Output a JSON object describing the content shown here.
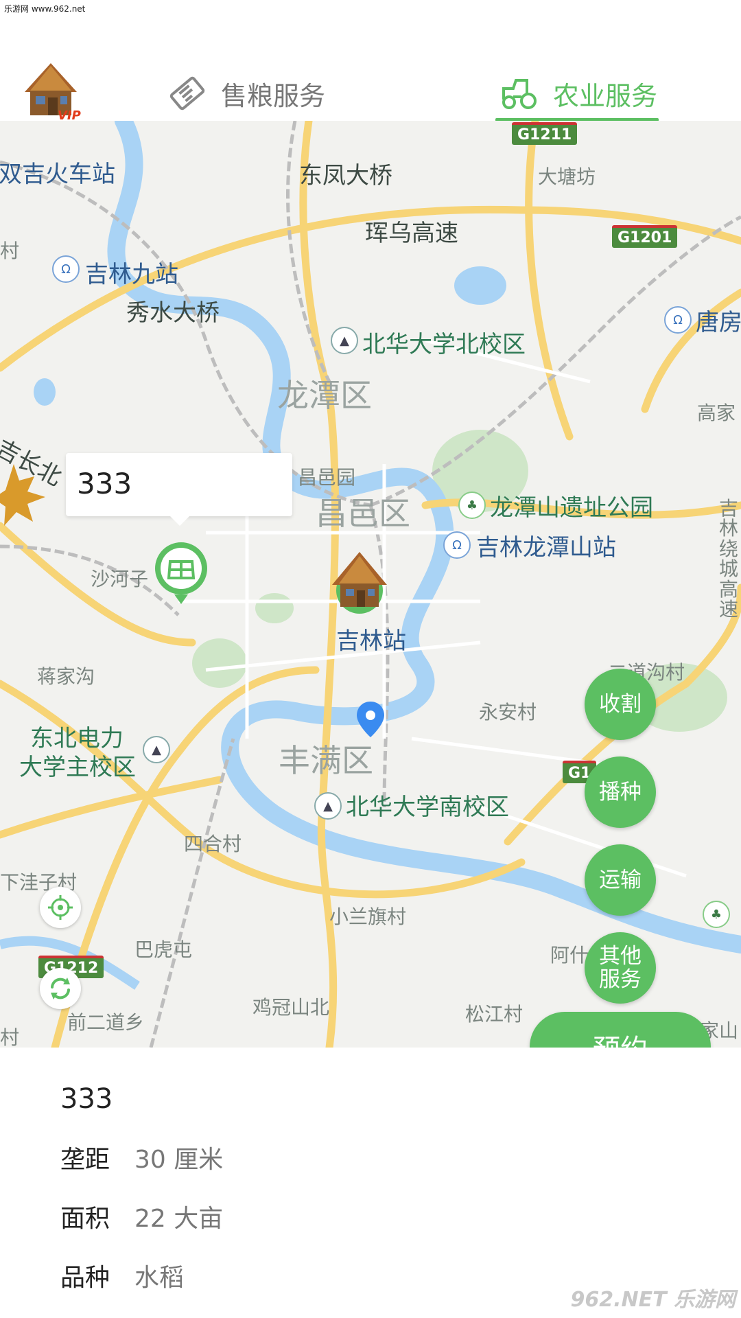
{
  "watermark_top": "乐游网 www.962.net",
  "header": {
    "avatar_badge": "VIP",
    "tabs": [
      {
        "label": "售粮服务",
        "icon": "ticket-icon",
        "active": false
      },
      {
        "label": "农业服务",
        "icon": "tractor-icon",
        "active": true
      }
    ]
  },
  "map": {
    "labels": {
      "l1": "双吉火车站",
      "l2": "东凤大桥",
      "l3": "大塘坊",
      "l4": "珲乌高速",
      "l5": "吉林九站",
      "l6": "秀水大桥",
      "l7": "北华大学北校区",
      "l8": "唐房",
      "l9": "龙潭区",
      "l10": "高家",
      "l11": "吉长北",
      "l12": "昌邑园",
      "l13": "昌邑区",
      "l14": "龙潭山遗址公园",
      "l15": "吉林龙潭山站",
      "l16": "沙河子",
      "l17": "吉林站",
      "l18": "蒋家沟",
      "l19": "二道沟村",
      "l20": "永安村",
      "l21": "东北电力",
      "l22": "大学主校区",
      "l23": "丰满区",
      "l24": "北华大学南校区",
      "l25": "四合村",
      "l26": "下洼子村",
      "l27": "小兰旗村",
      "l28": "巴虎屯",
      "l29": "阿什",
      "l30": "鸡冠山北",
      "l31": "前二道乡",
      "l32": "松江村",
      "l33": "吉林绕城高速",
      "l34": "村",
      "l35": "村",
      "l36": "家山"
    },
    "highways": {
      "g1211": "G1211",
      "g1201": "G1201",
      "g1212": "G1212",
      "g1x": "G1"
    },
    "callout_text": "333"
  },
  "actions": {
    "harvest": "收割",
    "sow": "播种",
    "transport": "运输",
    "other": "其他\n服务",
    "reserve": "预约"
  },
  "info": {
    "title": "333",
    "rows": [
      {
        "key": "垄距",
        "value": "30 厘米"
      },
      {
        "key": "面积",
        "value": "22 大亩"
      },
      {
        "key": "品种",
        "value": "水稻"
      }
    ]
  },
  "watermark_bottom": "962.NET 乐游网",
  "colors": {
    "accent": "#5cbf62",
    "tab_inactive": "#777777"
  }
}
